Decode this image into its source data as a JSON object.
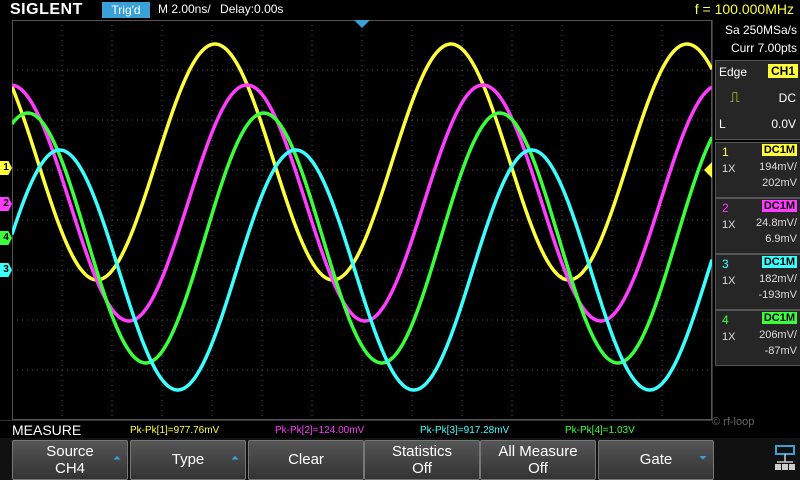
{
  "header": {
    "logo": "SIGLENT",
    "trigger_state": "Trig'd",
    "timebase": "M 2.00ns/",
    "delay": "Delay:0.00s",
    "frequency": "f = 100.000MHz"
  },
  "right_panel": {
    "sample_rate": "Sa 250MSa/s",
    "curr_points": "Curr 7.00pts",
    "trigger_type": "Edge",
    "trigger_source": "CH1",
    "trigger_coupling": "DC",
    "trigger_mode": "L",
    "trigger_level": "0.0V",
    "channels": [
      {
        "num": "1",
        "coupling": "DC1M",
        "probe": "1X",
        "vdiv": "194mV/",
        "offset": "202mV",
        "color": "#ffff3c"
      },
      {
        "num": "2",
        "coupling": "DC1M",
        "probe": "1X",
        "vdiv": "24.8mV/",
        "offset": "6.9mV",
        "color": "#ff3cff"
      },
      {
        "num": "3",
        "coupling": "DC1M",
        "probe": "1X",
        "vdiv": "182mV/",
        "offset": "-193mV",
        "color": "#3cffff"
      },
      {
        "num": "4",
        "coupling": "DC1M",
        "probe": "1X",
        "vdiv": "206mV/",
        "offset": "-87mV",
        "color": "#3cff3c"
      }
    ]
  },
  "measure": {
    "title": "MEASURE",
    "items": [
      {
        "text": "Pk-Pk[1]=977.76mV",
        "color": "#ffff3c"
      },
      {
        "text": "Pk-Pk[2]=124.00mV",
        "color": "#ff3cff"
      },
      {
        "text": "Pk-Pk[3]=917.28mV",
        "color": "#3cffff"
      },
      {
        "text": "Pk-Pk[4]=1.03V",
        "color": "#3cff3c"
      }
    ],
    "watermark": "rf-loop"
  },
  "softkeys": [
    {
      "line1": "Source",
      "line2": "CH4",
      "arrow": "⏶"
    },
    {
      "line1": "Type",
      "line2": "",
      "arrow": "⏶"
    },
    {
      "line1": "Clear",
      "line2": "",
      "arrow": ""
    },
    {
      "line1": "Statistics",
      "line2": "Off",
      "arrow": ""
    },
    {
      "line1": "All Measure",
      "line2": "Off",
      "arrow": ""
    },
    {
      "line1": "Gate",
      "line2": "",
      "arrow": "⏷"
    }
  ],
  "channel_markers": [
    {
      "num": "1",
      "color": "#ffff3c"
    },
    {
      "num": "2",
      "color": "#ff3cff"
    },
    {
      "num": "4",
      "color": "#3cff3c"
    },
    {
      "num": "3",
      "color": "#3cffff"
    }
  ],
  "grid_color": "#555555",
  "waveforms": [
    {
      "channel": "1",
      "color": "#ffff3c"
    },
    {
      "channel": "2",
      "color": "#ff3cff"
    },
    {
      "channel": "4",
      "color": "#3cff3c"
    },
    {
      "channel": "3",
      "color": "#3cffff"
    }
  ]
}
